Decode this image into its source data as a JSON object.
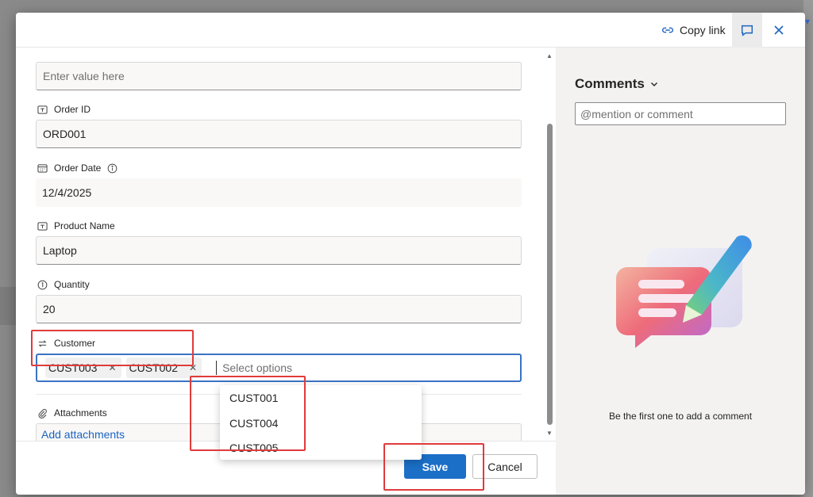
{
  "header": {
    "copy_link_label": "Copy link",
    "comment_toggle_icon": "comment-icon",
    "close_icon": "close-icon"
  },
  "form": {
    "top_field": {
      "placeholder": "Enter value here"
    },
    "order_id": {
      "label": "Order ID",
      "value": "ORD001"
    },
    "order_date": {
      "label": "Order Date",
      "value": "12/4/2025"
    },
    "product_name": {
      "label": "Product Name",
      "value": "Laptop"
    },
    "quantity": {
      "label": "Quantity",
      "value": "20"
    },
    "customer": {
      "label": "Customer",
      "selected": [
        "CUST003",
        "CUST002"
      ],
      "placeholder": "Select options",
      "options": [
        "CUST001",
        "CUST004",
        "CUST005"
      ]
    },
    "attachments": {
      "label": "Attachments",
      "add_label": "Add attachments"
    }
  },
  "footer": {
    "save_label": "Save",
    "cancel_label": "Cancel"
  },
  "comments": {
    "title": "Comments",
    "input_placeholder": "@mention or comment",
    "empty_message": "Be the first one to add a comment"
  },
  "colors": {
    "accent": "#1b6fc7",
    "focus_border": "#3a73c4",
    "highlight_red": "#e03b3b",
    "link": "#1b64c2"
  }
}
